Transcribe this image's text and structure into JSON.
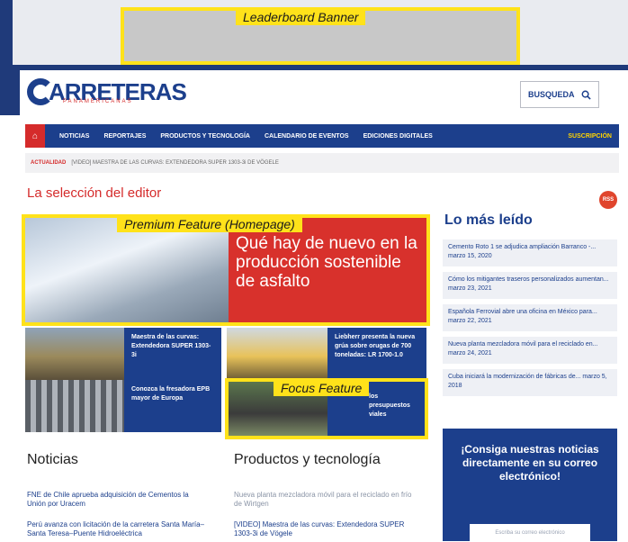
{
  "annotations": {
    "leaderboard": "Leaderboard Banner",
    "premium": "Premium Feature (Homepage)",
    "focus": "Focus Feature"
  },
  "brand": {
    "logo_text": "ARRETERAS",
    "logo_sub": "PANAMERICANAS"
  },
  "search": {
    "label": "BUSQUEDA",
    "icon": "search-icon"
  },
  "nav": {
    "home_icon": "home-icon",
    "items": [
      "NOTICIAS",
      "REPORTAJES",
      "PRODUCTOS Y TECNOLOGÍA",
      "CALENDARIO DE EVENTOS",
      "EDICIONES DIGITALES"
    ],
    "subscribe": "SUSCRIPCIÓN"
  },
  "ticker": {
    "label": "ACTUALIDAD",
    "text": "[VIDEO] MAESTRA DE LAS CURVAS: EXTENDEDORA SUPER 1303-3i DE VÖGELE"
  },
  "editor": {
    "title": "La selección del editor",
    "rss": "RSS",
    "premium_headline": "Qué hay de nuevo en la producción sostenible de asfalto",
    "tiles": [
      "Maestra de las curvas: Extendedora SUPER 1303-3i",
      "Conozca la fresadora EPB mayor de Europa",
      "Liebherr presenta la nueva grúa sobre orugas de 700 toneladas: LR 1700-1.0",
      "los presupuestos viales"
    ]
  },
  "noticias": {
    "title": "Noticias",
    "items": [
      "FNE de Chile aprueba adquisición de Cementos la Unión por Uracem",
      "Perú avanza con licitación de la carretera Santa María–Santa Teresa–Puente Hidroeléctrica"
    ]
  },
  "productos": {
    "title": "Productos y tecnología",
    "items": [
      "Nueva planta mezcladora móvil para el reciclado en frío de Wirtgen",
      "[VIDEO] Maestra de las curvas: Extendedora SUPER 1303-3i de Vögele"
    ]
  },
  "mas_leido": {
    "title": "Lo más leído",
    "items": [
      "Cemento Roto 1 se adjudica ampliación Barranco -... marzo 15, 2020",
      "Cómo los mitigantes traseros personalizados aumentan... marzo 23, 2021",
      "Española Ferrovial abre una oficina en México para... marzo 22, 2021",
      "Nueva planta mezcladora móvil para el reciclado en... marzo 24, 2021",
      "Cuba iniciará la modernización de fábricas de... marzo 5, 2018"
    ]
  },
  "subscribe_box": {
    "message": "¡Consiga nuestras noticias directamente en su correo electrónico!",
    "input_placeholder": "Escriba su correo electrónico"
  }
}
